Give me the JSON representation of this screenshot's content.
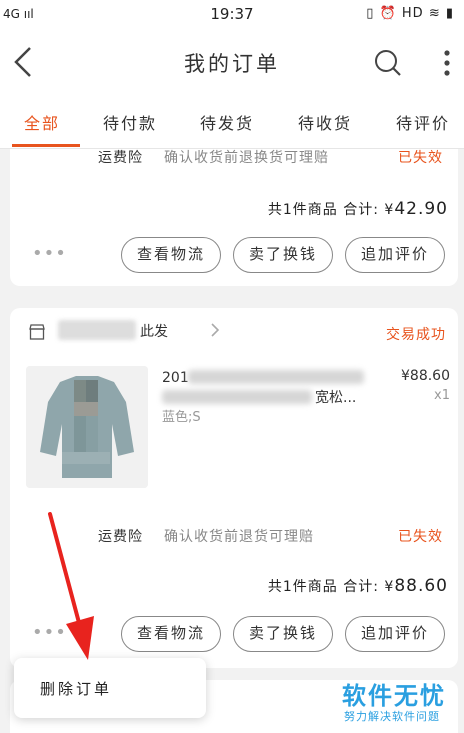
{
  "status_bar": {
    "network": "4G ııl",
    "time": "19:37",
    "right_icons": "▯ ⏰ HD ≋ ▮"
  },
  "header": {
    "title": "我的订单"
  },
  "tabs": [
    {
      "label": "全部",
      "active": true
    },
    {
      "label": "待付款"
    },
    {
      "label": "待发货"
    },
    {
      "label": "待收货"
    },
    {
      "label": "待评价"
    }
  ],
  "order1": {
    "insurance_label": "运费险",
    "insurance_desc": "确认收货前退换货可理赔",
    "insurance_status": "已失效",
    "total_prefix": "共1件商品  合计: ¥",
    "total_amount": "42.90",
    "more": "•••",
    "buttons": [
      "查看物流",
      "卖了换钱",
      "追加评价"
    ]
  },
  "order2": {
    "store_name": "此发",
    "status": "交易成功",
    "product_title_visible": "201",
    "product_title_tail": "宽松...",
    "sku": "蓝色;S",
    "price": "¥88.60",
    "qty": "x1",
    "insurance_label": "运费险",
    "insurance_desc": "确认收货前退货可理赔",
    "insurance_status": "已失效",
    "total_prefix": "共1件商品  合计: ¥",
    "total_amount": "88.60",
    "more": "•••",
    "buttons": [
      "查看物流",
      "卖了换钱",
      "追加评价"
    ]
  },
  "popup_menu": {
    "item": "删除订单"
  },
  "watermark": {
    "main": "软件无忧",
    "sub": "努力解决软件问题"
  },
  "colors": {
    "accent": "#e8541e",
    "watermark": "#2a9fe0",
    "arrow": "#e8231e"
  }
}
